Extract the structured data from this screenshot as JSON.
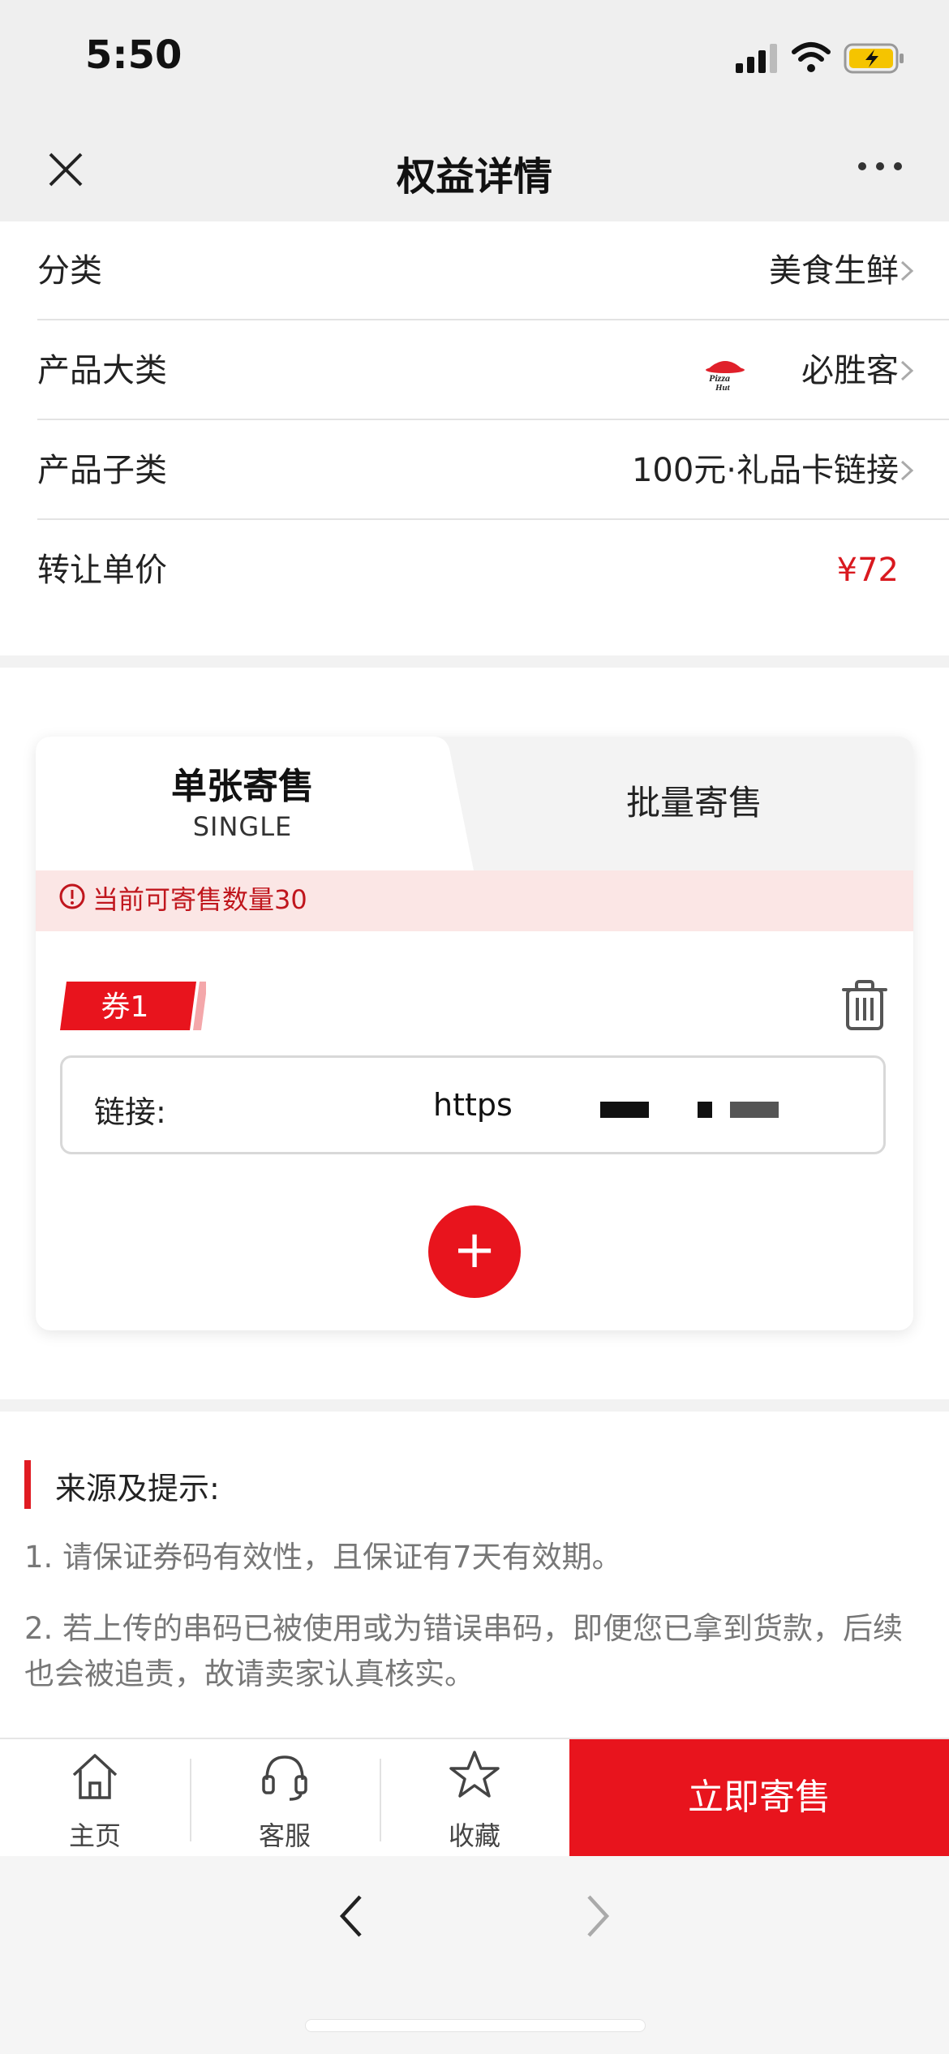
{
  "status_bar": {
    "time": "5:50"
  },
  "nav": {
    "title": "权益详情"
  },
  "info_rows": [
    {
      "label": "分类",
      "value": "美食生鲜"
    },
    {
      "label": "产品大类",
      "value": "必胜客"
    },
    {
      "label": "产品子类",
      "value": "100元·礼品卡链接"
    },
    {
      "label": "转让单价",
      "value": "¥72"
    }
  ],
  "tabs": {
    "single_title": "单张寄售",
    "single_sub": "SINGLE",
    "batch_title": "批量寄售"
  },
  "notice": "当前可寄售数量30",
  "coupon": {
    "tag": "券1",
    "link_label": "链接:",
    "link_value": "https"
  },
  "add_symbol": "+",
  "tips": {
    "title": "来源及提示:",
    "items": [
      "1. 请保证券码有效性，且保证有7天有效期。",
      "2. 若上传的串码已被使用或为错误串码，即便您已拿到货款，后续也会被追责，故请卖家认真核实。"
    ]
  },
  "bottom_bar": {
    "home": "主页",
    "service": "客服",
    "favorite": "收藏",
    "sell_now": "立即寄售"
  },
  "colors": {
    "accent": "#e8141d",
    "price": "#d9191f",
    "notice_bg": "#fbe6e5"
  }
}
